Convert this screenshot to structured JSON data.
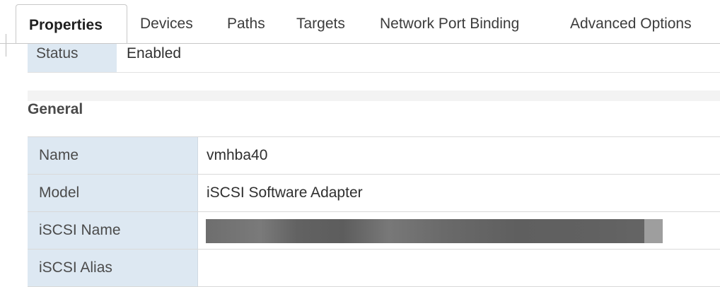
{
  "tabs": [
    {
      "label": "Properties",
      "active": true
    },
    {
      "label": "Devices"
    },
    {
      "label": "Paths"
    },
    {
      "label": "Targets"
    },
    {
      "label": "Network Port Binding"
    },
    {
      "label": "Advanced Options"
    }
  ],
  "status_row": {
    "key": "Status",
    "value": "Enabled"
  },
  "general": {
    "title": "General",
    "rows": [
      {
        "key": "Name",
        "value": "vmhba40"
      },
      {
        "key": "Model",
        "value": "iSCSI Software Adapter"
      },
      {
        "key": "iSCSI Name",
        "value": ""
      },
      {
        "key": "iSCSI Alias",
        "value": ""
      }
    ]
  },
  "colors": {
    "key_cell_bg": "#dde8f2",
    "redaction": "#6a6a6a"
  }
}
